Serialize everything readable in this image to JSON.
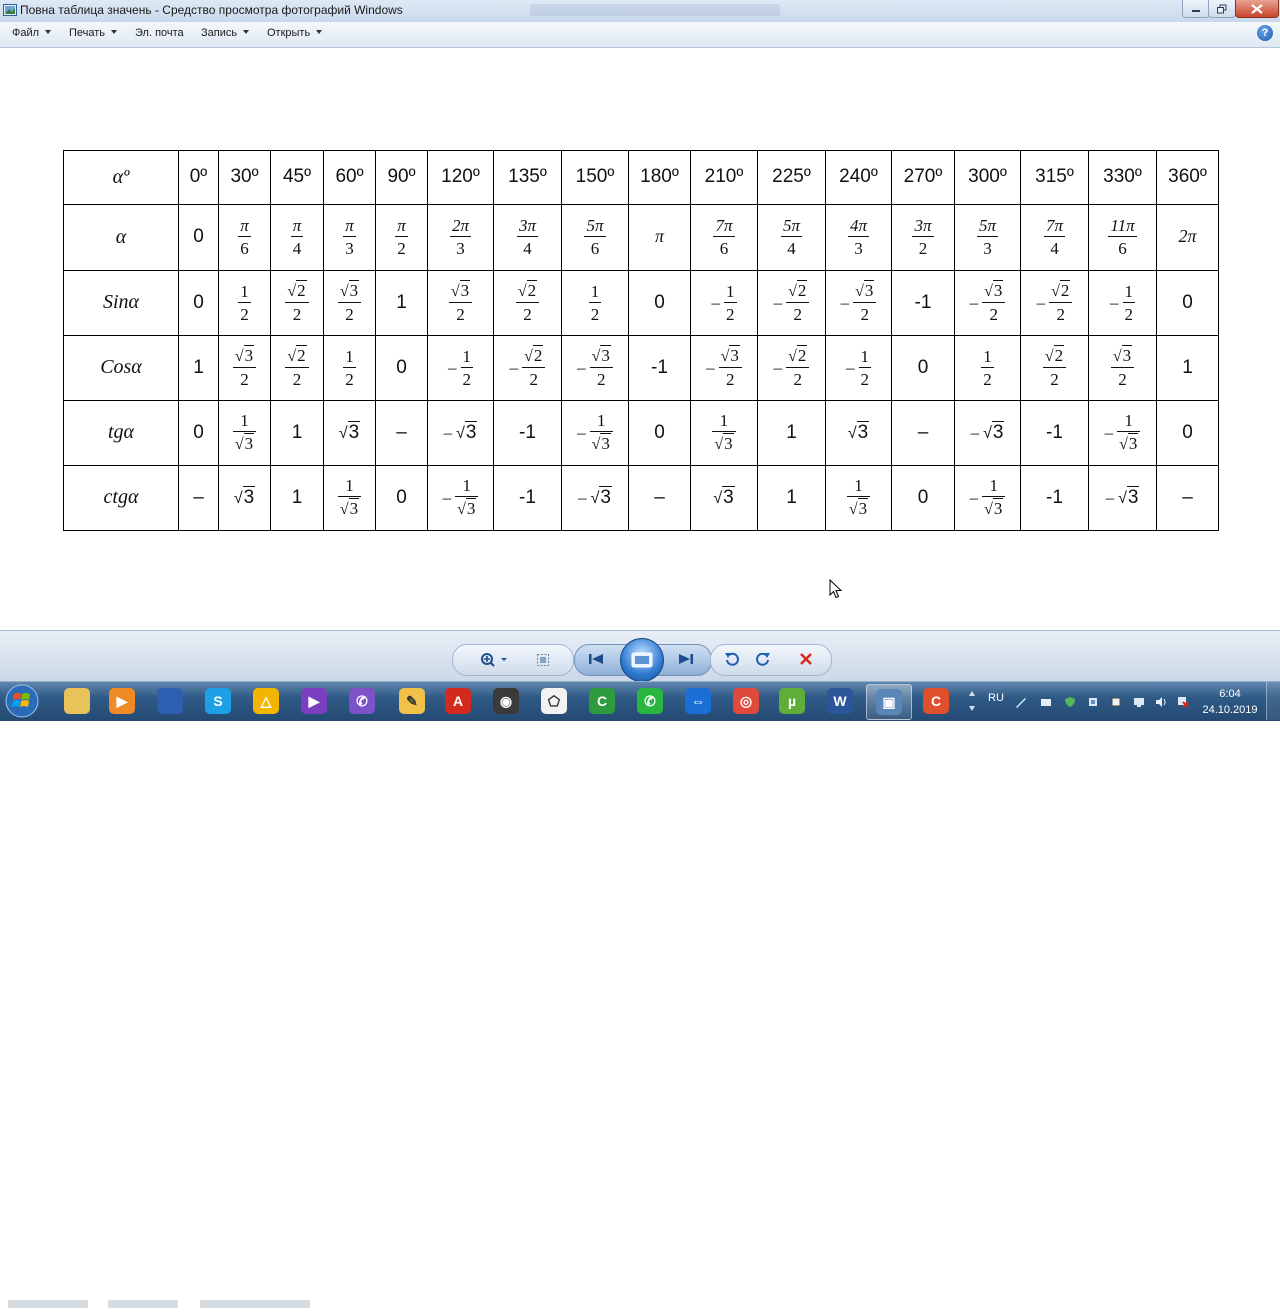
{
  "window": {
    "title": "Повна таблица значень - Средство просмотра фотографий Windows"
  },
  "menu": {
    "items": [
      "Файл",
      "Печать",
      "Эл. почта",
      "Запись",
      "Открыть"
    ]
  },
  "table": {
    "header_label": "αº",
    "degrees": [
      "0º",
      "30º",
      "45º",
      "60º",
      "90º",
      "120º",
      "135º",
      "150º",
      "180º",
      "210º",
      "225º",
      "240º",
      "270º",
      "300º",
      "315º",
      "330º",
      "360º"
    ],
    "rows": [
      {
        "label": "α",
        "cells": [
          {
            "t": "n",
            "v": "0"
          },
          {
            "t": "f",
            "n": "π",
            "d": "6"
          },
          {
            "t": "f",
            "n": "π",
            "d": "4"
          },
          {
            "t": "f",
            "n": "π",
            "d": "3"
          },
          {
            "t": "f",
            "n": "π",
            "d": "2"
          },
          {
            "t": "f",
            "n": "2π",
            "d": "3"
          },
          {
            "t": "f",
            "n": "3π",
            "d": "4"
          },
          {
            "t": "f",
            "n": "5π",
            "d": "6"
          },
          {
            "t": "m",
            "v": "π"
          },
          {
            "t": "f",
            "n": "7π",
            "d": "6"
          },
          {
            "t": "f",
            "n": "5π",
            "d": "4"
          },
          {
            "t": "f",
            "n": "4π",
            "d": "3"
          },
          {
            "t": "f",
            "n": "3π",
            "d": "2"
          },
          {
            "t": "f",
            "n": "5π",
            "d": "3"
          },
          {
            "t": "f",
            "n": "7π",
            "d": "4"
          },
          {
            "t": "f",
            "n": "11π",
            "d": "6"
          },
          {
            "t": "m",
            "v": "2π"
          }
        ]
      },
      {
        "label": "Sinα",
        "cells": [
          {
            "t": "n",
            "v": "0"
          },
          {
            "t": "f",
            "n": "1",
            "d": "2"
          },
          {
            "t": "f",
            "n": "√2",
            "d": "2"
          },
          {
            "t": "f",
            "n": "√3",
            "d": "2"
          },
          {
            "t": "n",
            "v": "1"
          },
          {
            "t": "f",
            "n": "√3",
            "d": "2"
          },
          {
            "t": "f",
            "n": "√2",
            "d": "2"
          },
          {
            "t": "f",
            "n": "1",
            "d": "2"
          },
          {
            "t": "n",
            "v": "0"
          },
          {
            "t": "f",
            "s": "–",
            "n": "1",
            "d": "2"
          },
          {
            "t": "f",
            "s": "–",
            "n": "√2",
            "d": "2"
          },
          {
            "t": "f",
            "s": "–",
            "n": "√3",
            "d": "2"
          },
          {
            "t": "n",
            "v": "-1"
          },
          {
            "t": "f",
            "s": "–",
            "n": "√3",
            "d": "2"
          },
          {
            "t": "f",
            "s": "–",
            "n": "√2",
            "d": "2"
          },
          {
            "t": "f",
            "s": "–",
            "n": "1",
            "d": "2"
          },
          {
            "t": "n",
            "v": "0"
          }
        ]
      },
      {
        "label": "Cosα",
        "cells": [
          {
            "t": "n",
            "v": "1"
          },
          {
            "t": "f",
            "n": "√3",
            "d": "2"
          },
          {
            "t": "f",
            "n": "√2",
            "d": "2"
          },
          {
            "t": "f",
            "n": "1",
            "d": "2"
          },
          {
            "t": "n",
            "v": "0"
          },
          {
            "t": "f",
            "s": "–",
            "n": "1",
            "d": "2"
          },
          {
            "t": "f",
            "s": "–",
            "n": "√2",
            "d": "2"
          },
          {
            "t": "f",
            "s": "–",
            "n": "√3",
            "d": "2"
          },
          {
            "t": "n",
            "v": "-1"
          },
          {
            "t": "f",
            "s": "–",
            "n": "√3",
            "d": "2"
          },
          {
            "t": "f",
            "s": "–",
            "n": "√2",
            "d": "2"
          },
          {
            "t": "f",
            "s": "–",
            "n": "1",
            "d": "2"
          },
          {
            "t": "n",
            "v": "0"
          },
          {
            "t": "f",
            "n": "1",
            "d": "2"
          },
          {
            "t": "f",
            "n": "√2",
            "d": "2"
          },
          {
            "t": "f",
            "n": "√3",
            "d": "2"
          },
          {
            "t": "n",
            "v": "1"
          }
        ]
      },
      {
        "label": "tgα",
        "cells": [
          {
            "t": "n",
            "v": "0"
          },
          {
            "t": "f",
            "n": "1",
            "d": "√3"
          },
          {
            "t": "n",
            "v": "1"
          },
          {
            "t": "r",
            "v": "√3"
          },
          {
            "t": "n",
            "v": "–"
          },
          {
            "t": "r",
            "s": "–",
            "v": "√3"
          },
          {
            "t": "n",
            "v": "-1"
          },
          {
            "t": "f",
            "s": "–",
            "n": "1",
            "d": "√3"
          },
          {
            "t": "n",
            "v": "0"
          },
          {
            "t": "f",
            "n": "1",
            "d": "√3"
          },
          {
            "t": "n",
            "v": "1"
          },
          {
            "t": "r",
            "v": "√3"
          },
          {
            "t": "n",
            "v": "–"
          },
          {
            "t": "r",
            "s": "–",
            "v": "√3"
          },
          {
            "t": "n",
            "v": "-1"
          },
          {
            "t": "f",
            "s": "–",
            "n": "1",
            "d": "√3"
          },
          {
            "t": "n",
            "v": "0"
          }
        ]
      },
      {
        "label": "ctgα",
        "cells": [
          {
            "t": "n",
            "v": "–"
          },
          {
            "t": "r",
            "v": "√3"
          },
          {
            "t": "n",
            "v": "1"
          },
          {
            "t": "f",
            "n": "1",
            "d": "√3"
          },
          {
            "t": "n",
            "v": "0"
          },
          {
            "t": "f",
            "s": "–",
            "n": "1",
            "d": "√3"
          },
          {
            "t": "n",
            "v": "-1"
          },
          {
            "t": "r",
            "s": "–",
            "v": "√3"
          },
          {
            "t": "n",
            "v": "–"
          },
          {
            "t": "r",
            "v": "√3"
          },
          {
            "t": "n",
            "v": "1"
          },
          {
            "t": "f",
            "n": "1",
            "d": "√3"
          },
          {
            "t": "n",
            "v": "0"
          },
          {
            "t": "f",
            "s": "–",
            "n": "1",
            "d": "√3"
          },
          {
            "t": "n",
            "v": "-1"
          },
          {
            "t": "r",
            "s": "–",
            "v": "√3"
          },
          {
            "t": "n",
            "v": "–"
          }
        ]
      }
    ]
  },
  "taskbar": {
    "apps": [
      {
        "name": "windows-explorer-icon",
        "color": "#e9c35a",
        "glyph": ""
      },
      {
        "name": "media-player-icon",
        "color": "#f08a24",
        "glyph": "▶"
      },
      {
        "name": "save-disk-icon",
        "color": "#2c5fb0",
        "glyph": ""
      },
      {
        "name": "skype-icon",
        "color": "#1ea0e6",
        "glyph": "S"
      },
      {
        "name": "archicad-icon",
        "color": "#f2b600",
        "glyph": "△"
      },
      {
        "name": "visual-studio-icon",
        "color": "#7a3fc0",
        "glyph": "▶"
      },
      {
        "name": "viber-icon",
        "color": "#7d52c8",
        "glyph": "✆"
      },
      {
        "name": "paint-icon",
        "color": "#f2c14a",
        "glyph": "✎"
      },
      {
        "name": "acrobat-icon",
        "color": "#d32a1e",
        "glyph": "A"
      },
      {
        "name": "disc-burner-icon",
        "color": "#3a3a3a",
        "glyph": "◉"
      },
      {
        "name": "geogebra-icon",
        "color": "#f2f2f2",
        "glyph": "⬠"
      },
      {
        "name": "camtasia-icon",
        "color": "#2e9c3e",
        "glyph": "C"
      },
      {
        "name": "whatsapp-icon",
        "color": "#2ab540",
        "glyph": "✆"
      },
      {
        "name": "teamviewer-icon",
        "color": "#1a6fd6",
        "glyph": "⇔"
      },
      {
        "name": "chrome-icon",
        "color": "#e04a3a",
        "glyph": "◎"
      },
      {
        "name": "utorrent-icon",
        "color": "#5fae3a",
        "glyph": "µ"
      },
      {
        "name": "word-icon",
        "color": "#2b579a",
        "glyph": "W"
      },
      {
        "name": "photo-viewer-icon",
        "color": "#5a86b8",
        "glyph": "▣"
      },
      {
        "name": "screen-recorder-icon",
        "color": "#e0502c",
        "glyph": "C"
      }
    ],
    "language": "RU",
    "time": "6:04",
    "date": "24.10.2019"
  }
}
